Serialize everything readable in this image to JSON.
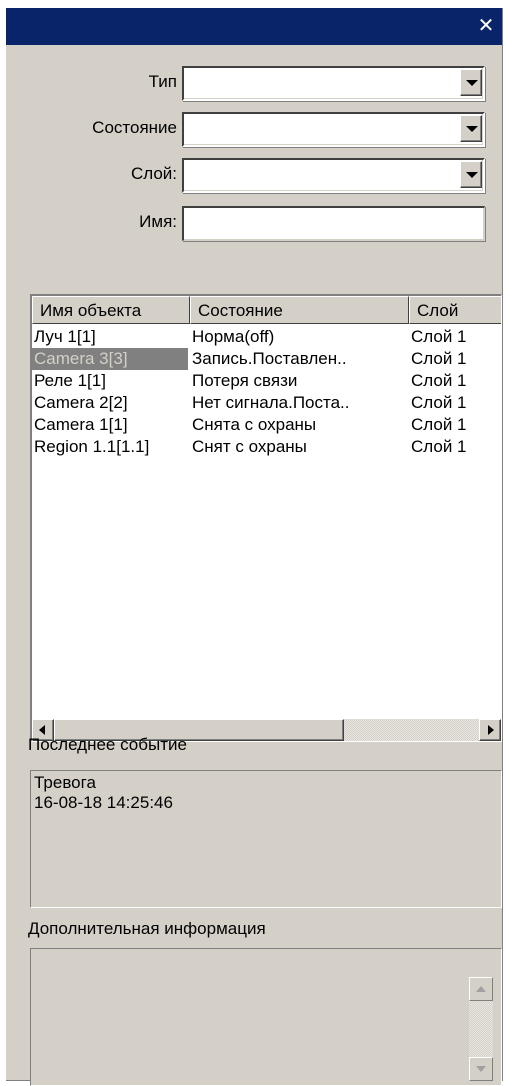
{
  "window": {
    "close_glyph": "✕",
    "titlebar_color": "#0a246a",
    "face_color": "#d4d0c8"
  },
  "filters": {
    "type_label": "Тип",
    "type_value": "",
    "state_label": "Состояние",
    "state_value": "",
    "layer_label": "Слой:",
    "layer_value": "",
    "name_label": "Имя:",
    "name_value": ""
  },
  "objects_table": {
    "columns": [
      "Имя объекта",
      "Состояние",
      "Слой"
    ],
    "rows": [
      {
        "name": "Луч 1[1]",
        "state": "Норма(off)",
        "layer": "Слой 1",
        "selected": false
      },
      {
        "name": "Camera 3[3]",
        "state": "Запись.Поставлен..",
        "layer": "Слой 1",
        "selected": true
      },
      {
        "name": "Реле 1[1]",
        "state": "Потеря связи",
        "layer": "Слой 1",
        "selected": false
      },
      {
        "name": "Camera 2[2]",
        "state": "Нет сигнала.Поста..",
        "layer": "Слой 1",
        "selected": false
      },
      {
        "name": "Camera 1[1]",
        "state": "Снята с охраны",
        "layer": "Слой 1",
        "selected": false
      },
      {
        "name": "Region 1.1[1.1]",
        "state": "Снят с охраны",
        "layer": "Слой 1",
        "selected": false
      }
    ]
  },
  "last_event": {
    "label": "Последнее событие",
    "line1": "Тревога",
    "line2": "16-08-18 14:25:46"
  },
  "additional_info": {
    "label": "Дополнительная информация",
    "text": ""
  },
  "icons": {
    "close": "close-icon",
    "dropdown": "chevron-down-icon",
    "scroll_left": "arrow-left-icon",
    "scroll_right": "arrow-right-icon",
    "scroll_up": "arrow-up-icon",
    "scroll_down": "arrow-down-icon"
  }
}
